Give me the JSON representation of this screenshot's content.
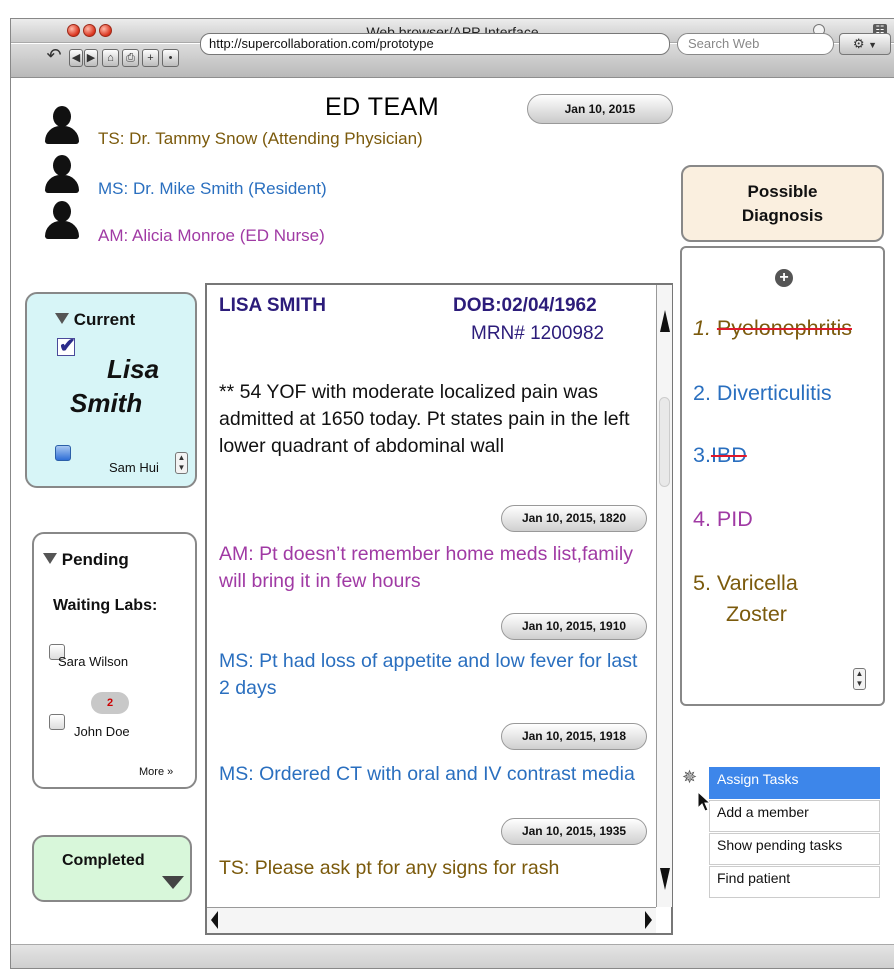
{
  "window": {
    "title": "Web browser/APP Interface"
  },
  "toolbar": {
    "url": "http://supercollaboration.com/prototype",
    "search_placeholder": "Search Web"
  },
  "header": {
    "title": "ED TEAM",
    "date": "Jan 10, 2015"
  },
  "team": [
    {
      "text": "TS: Dr. Tammy Snow  (Attending Physician)",
      "color": "#7b5a0c"
    },
    {
      "text": "MS: Dr. Mike Smith (Resident)",
      "color": "#2a6fbf"
    },
    {
      "text": "AM: Alicia Monroe (ED Nurse)",
      "color": "#a03aa4"
    }
  ],
  "current": {
    "label": "Current",
    "patient_line1": "Lisa",
    "patient_line2": "Smith",
    "other_patient": "Sam Hui"
  },
  "pending": {
    "label": "Pending",
    "subtitle": "Waiting Labs:",
    "patients": [
      "Sara Wilson",
      "John Doe"
    ],
    "badge_count": "2",
    "more": "More"
  },
  "completed": {
    "label": "Completed"
  },
  "notes": {
    "patient_name": "LISA SMITH",
    "dob": "DOB:02/04/1962",
    "mrn": "MRN# 1200982",
    "entries": [
      {
        "text": "** 54 YOF with moderate localized pain was admitted at 1650 today. Pt states pain in the left lower quadrant of abdominal wall",
        "color": "#111111"
      },
      {
        "timestamp": "Jan 10, 2015, 1820"
      },
      {
        "text": "AM: Pt doesn’t remember home meds list,family will bring it in few hours",
        "color": "#a03aa4"
      },
      {
        "timestamp": "Jan 10, 2015, 1910"
      },
      {
        "text": "MS: Pt had loss of appetite and low fever for last 2 days",
        "color": "#2a6fbf"
      },
      {
        "timestamp": "Jan 10, 2015, 1918"
      },
      {
        "text": "MS: Ordered CT with oral and IV contrast media",
        "color": "#2a6fbf"
      },
      {
        "timestamp": "Jan 10, 2015, 1935"
      },
      {
        "text": "TS: Please ask pt for any signs for rash",
        "color": "#7b5a0c"
      }
    ]
  },
  "diagnosis": {
    "title_line1": "Possible",
    "title_line2": "Diagnosis",
    "items": [
      {
        "num": "1.",
        "text": "Pyelonephritis",
        "color": "#7b5a0c",
        "struck": true
      },
      {
        "num": "2.",
        "text": "Diverticulitis",
        "color": "#2a6fbf",
        "struck": false
      },
      {
        "num": "3.",
        "text": "IBD",
        "color": "#2a6fbf",
        "struck": true
      },
      {
        "num": "4.",
        "text": "PID",
        "color": "#a03aa4",
        "struck": false
      },
      {
        "num": "5.",
        "text": "Varicella",
        "text2": "Zoster",
        "color": "#7b5a0c",
        "struck": false
      }
    ]
  },
  "context_menu": {
    "items": [
      "Assign Tasks",
      "Add a member",
      "Show pending tasks",
      "Find patient"
    ],
    "highlight_color": "#3d86ea"
  }
}
